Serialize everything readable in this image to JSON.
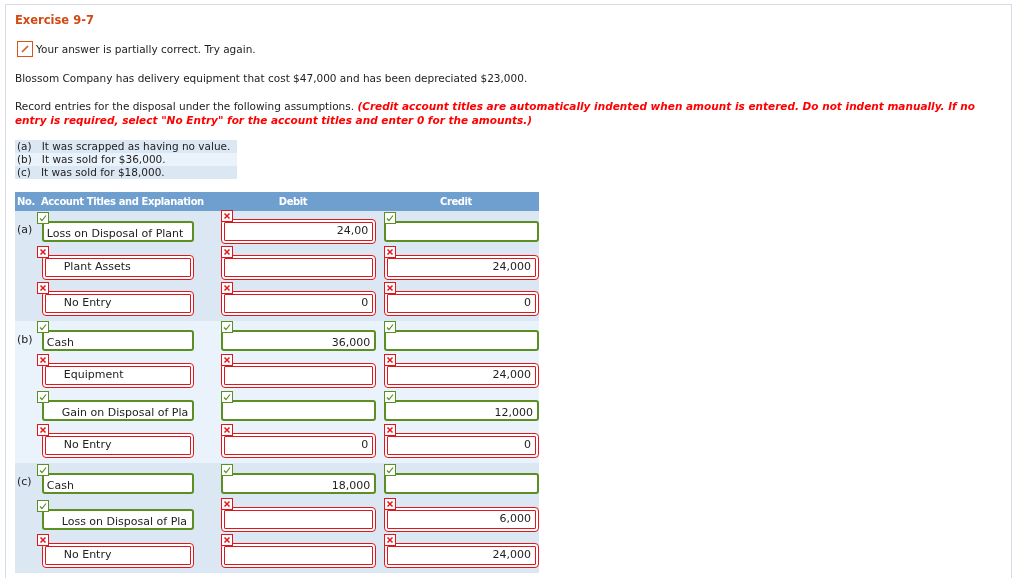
{
  "title": "Exercise 9-7",
  "feedback": {
    "partial": true,
    "text": "Your answer is partially correct.  Try again."
  },
  "problem": "Blossom Company has delivery equipment that cost $47,000 and has been depreciated $23,000.",
  "instructions": "Record entries for the disposal under the following assumptions. **(Credit account titles are automatically indented when amount is entered. Do not indent manually. If no entry is required, select \"No Entry\" for the account titles and enter 0 for the amounts.)**",
  "assumptions": [
    {
      "label": "(a)",
      "text": "It was scrapped as having no value."
    },
    {
      "label": "(b)",
      "text": "It was sold for $36,000."
    },
    {
      "label": "(c)",
      "text": "It was sold for $18,000."
    }
  ],
  "table": {
    "columns": [
      "No.",
      "Account Titles and Explanation",
      "Debit",
      "Credit"
    ],
    "groups": [
      {
        "label": "(a)",
        "rows": [
          {
            "account": {
              "value": "Loss on Disposal of Plant",
              "correct": true,
              "indented": false
            },
            "debit": {
              "value": "24,00",
              "correct": false
            },
            "credit": {
              "correct": true
            }
          },
          {
            "account": {
              "value": "Plant Assets",
              "correct": false,
              "indented": true
            },
            "debit": {
              "correct": false
            },
            "credit": {
              "value": "24,000",
              "correct": false
            }
          },
          {
            "account": {
              "value": "No Entry",
              "correct": false,
              "indented": true
            },
            "debit": {
              "value": "0",
              "correct": false
            },
            "credit": {
              "value": "0",
              "correct": false
            }
          }
        ]
      },
      {
        "label": "(b)",
        "rows": [
          {
            "account": {
              "value": "Cash",
              "correct": true,
              "indented": false
            },
            "debit": {
              "value": "36,000",
              "correct": true
            },
            "credit": {
              "correct": true
            }
          },
          {
            "account": {
              "value": "Equipment",
              "correct": false,
              "indented": true
            },
            "debit": {
              "correct": false
            },
            "credit": {
              "value": "24,000",
              "correct": false
            }
          },
          {
            "account": {
              "value": "Gain on Disposal of Pla",
              "correct": true,
              "indented": true
            },
            "debit": {
              "correct": true
            },
            "credit": {
              "value": "12,000",
              "correct": true
            }
          },
          {
            "account": {
              "value": "No Entry",
              "correct": false,
              "indented": true
            },
            "debit": {
              "value": "0",
              "correct": false
            },
            "credit": {
              "value": "0",
              "correct": false
            }
          }
        ]
      },
      {
        "label": "(c)",
        "rows": [
          {
            "account": {
              "value": "Cash",
              "correct": true,
              "indented": false
            },
            "debit": {
              "value": "18,000",
              "correct": true
            },
            "credit": {
              "correct": true
            }
          },
          {
            "account": {
              "value": "Loss on Disposal of Pla",
              "correct": true,
              "indented": true
            },
            "debit": {
              "correct": false
            },
            "credit": {
              "value": "6,000",
              "correct": false
            }
          },
          {
            "account": {
              "value": "No Entry",
              "correct": false,
              "indented": true
            },
            "debit": {
              "correct": false
            },
            "credit": {
              "value": "24,000",
              "correct": false
            }
          }
        ]
      }
    ]
  }
}
